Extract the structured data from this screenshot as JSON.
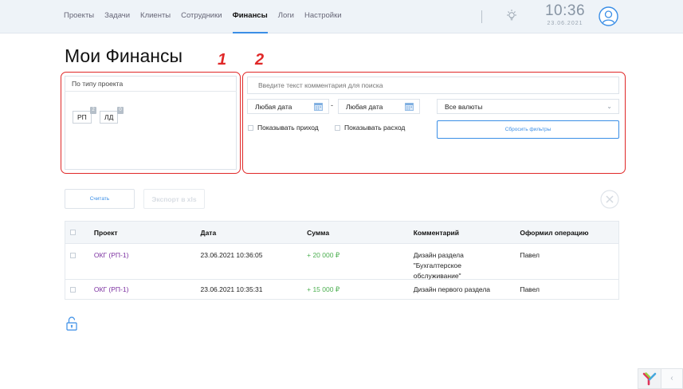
{
  "header": {
    "nav": [
      {
        "label": "Проекты",
        "active": false
      },
      {
        "label": "Задачи",
        "active": false
      },
      {
        "label": "Клиенты",
        "active": false
      },
      {
        "label": "Сотрудники",
        "active": false
      },
      {
        "label": "Финансы",
        "active": true
      },
      {
        "label": "Логи",
        "active": false
      },
      {
        "label": "Настройки",
        "active": false
      }
    ],
    "time": "10:36",
    "date": "23.06.2021",
    "accent_color": "#3a8ee6"
  },
  "page": {
    "title": "Мои Финансы",
    "annotation_1": "1",
    "annotation_2": "2",
    "annotation_color": "#e02828"
  },
  "project_filter": {
    "title": "По типу проекта",
    "chips": [
      {
        "label": "РП",
        "count": "2"
      },
      {
        "label": "ЛД",
        "count": "0"
      }
    ]
  },
  "filters": {
    "search_placeholder": "Введите текст комментария для поиска",
    "date_from": "Любая дата",
    "date_separator": "-",
    "date_to": "Любая дата",
    "currency": "Все валюты",
    "show_income": "Показывать приход",
    "show_expense": "Показывать расход",
    "reset_label": "Сбросить фильтры"
  },
  "actions": {
    "count_label": "Считать",
    "export_label": "Экспорт в xls"
  },
  "table": {
    "headers": [
      "Проект",
      "Дата",
      "Сумма",
      "Комментарий",
      "Оформил операцию"
    ],
    "rows": [
      {
        "project": "ОКГ (РП-1)",
        "date": "23.06.2021 10:36:05",
        "amount": "+ 20 000 ₽",
        "comment_lines": [
          "Дизайн раздела",
          "\"Бухгалтерское",
          "обслуживание\""
        ],
        "author": "Павел"
      },
      {
        "project": "ОКГ (РП-1)",
        "date": "23.06.2021 10:35:31",
        "amount": "+ 15 000 ₽",
        "comment_lines": [
          "Дизайн первого раздела"
        ],
        "author": "Павел"
      }
    ],
    "project_link_color": "#7b2fa0",
    "amount_color": "#4caf50"
  },
  "widget": {
    "collapse_glyph": "‹"
  }
}
